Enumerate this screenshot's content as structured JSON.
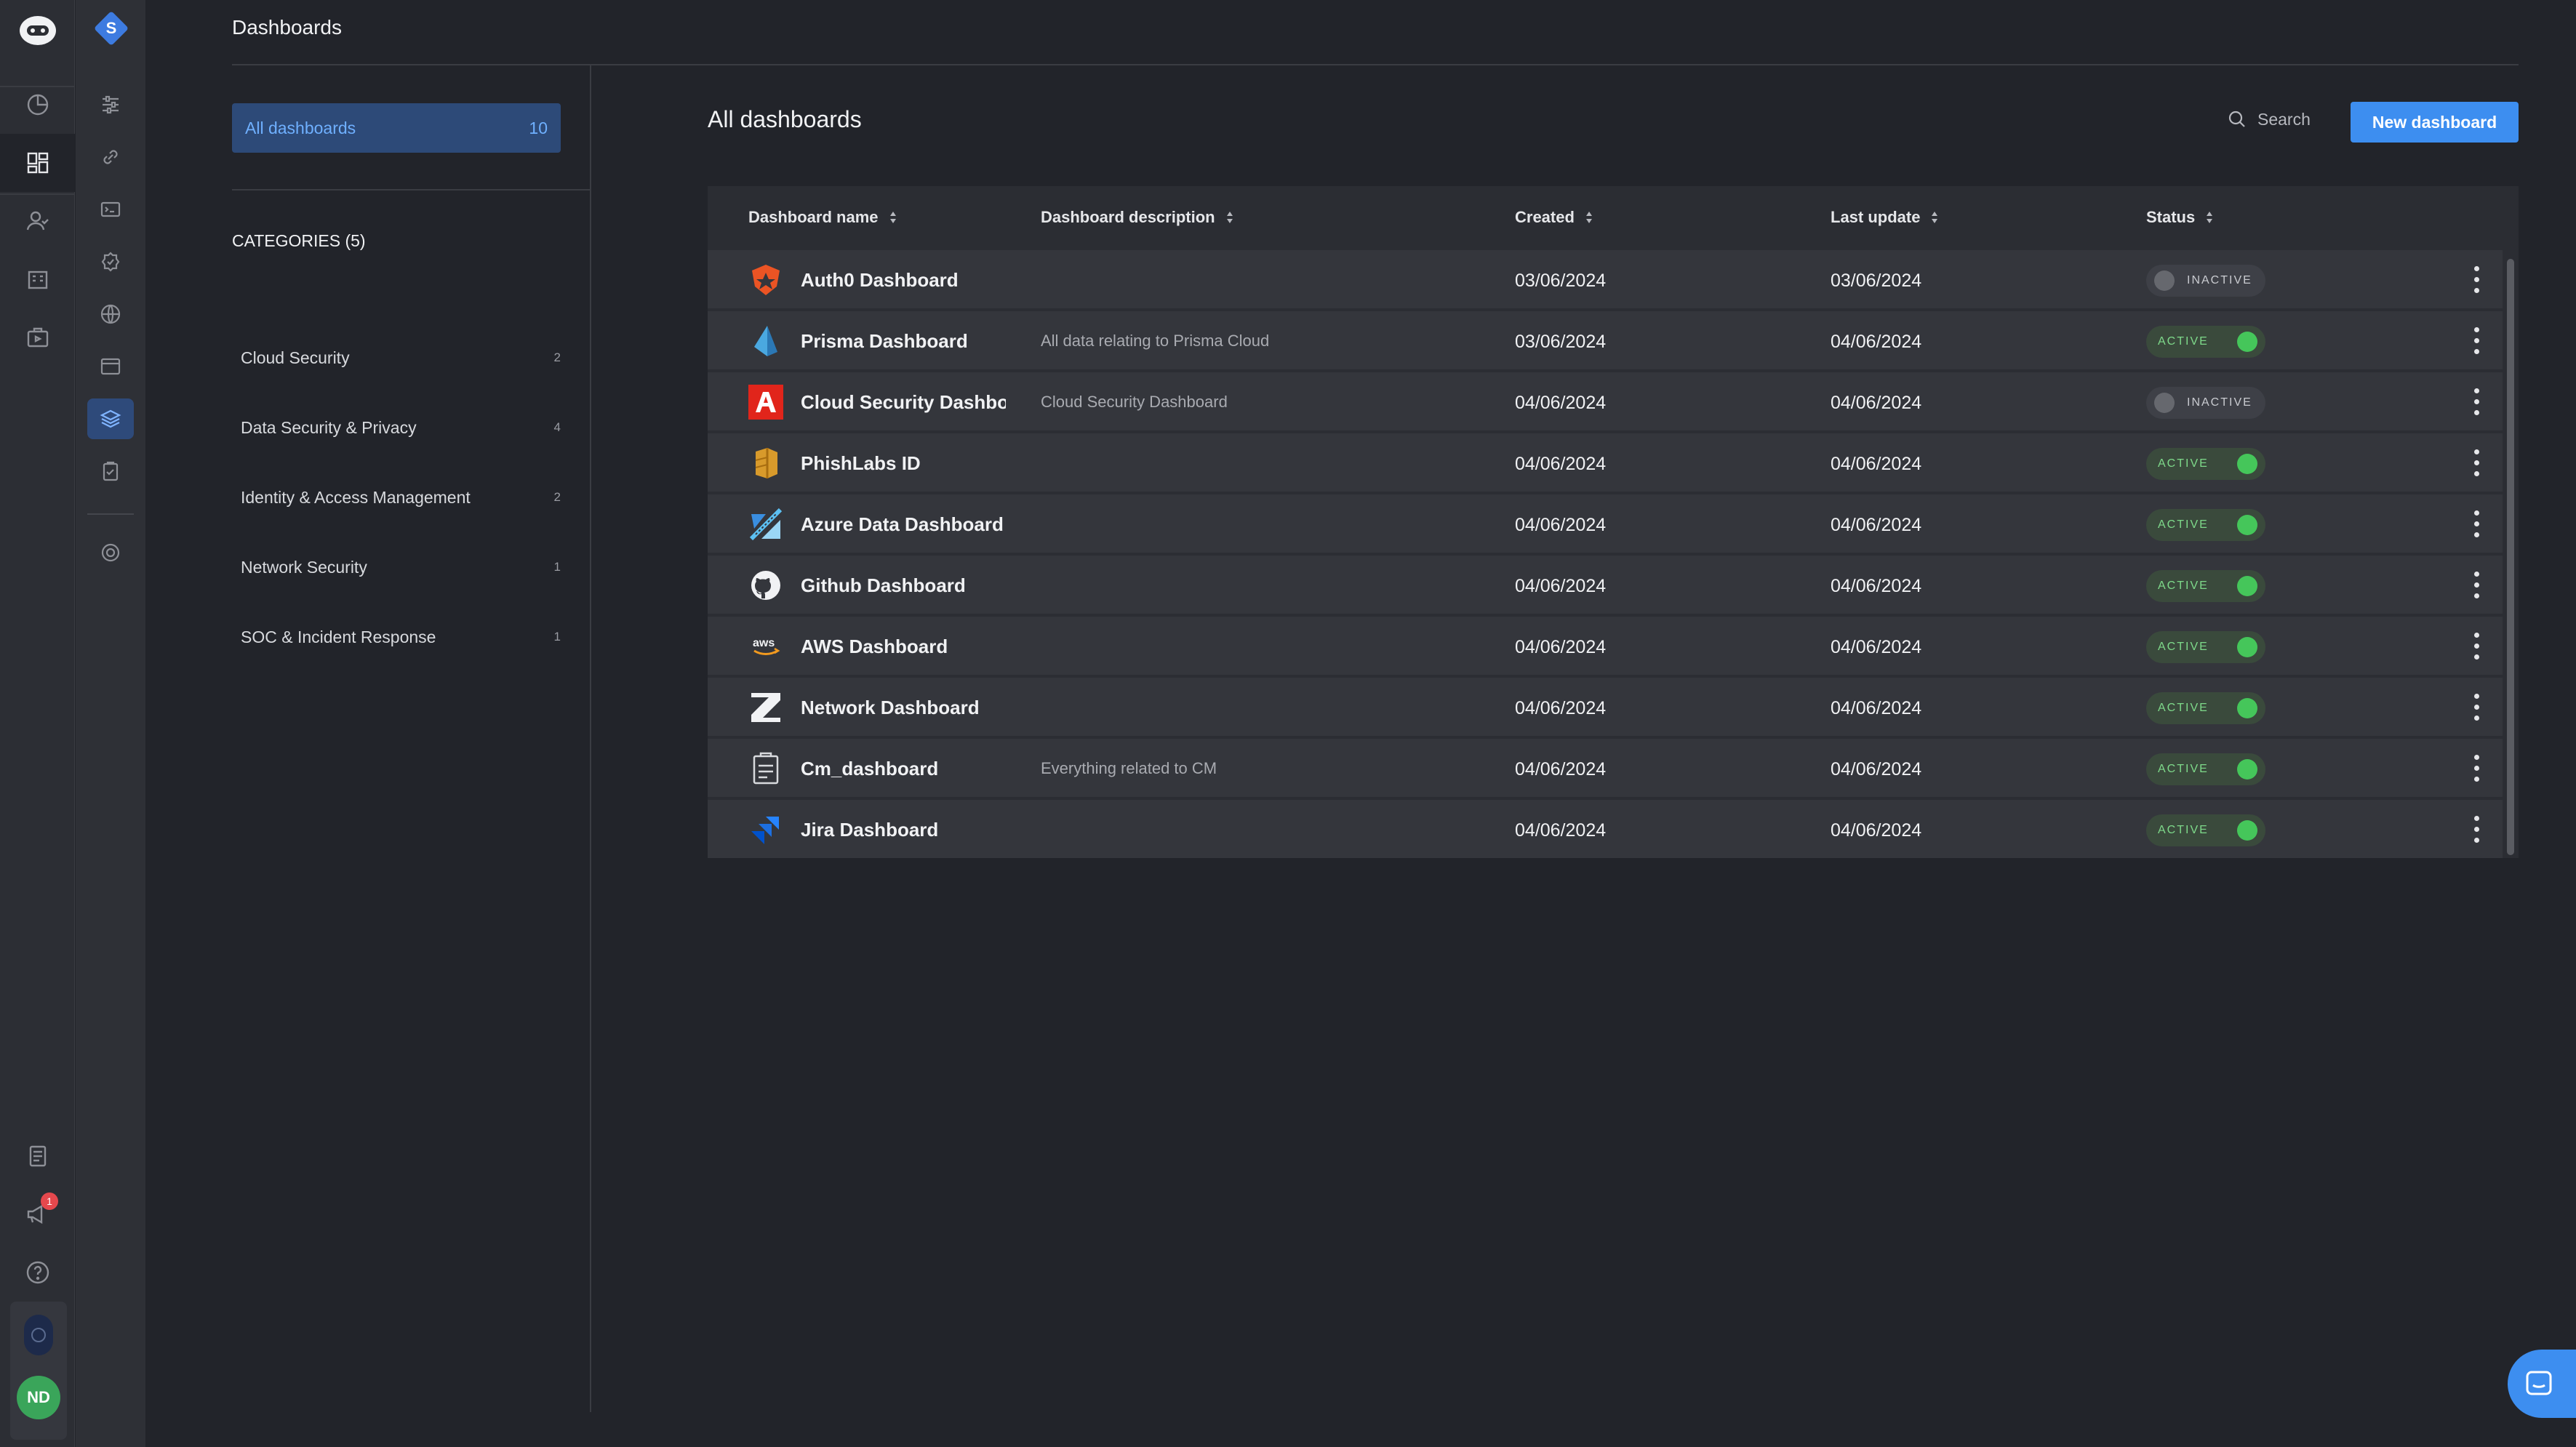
{
  "header": {
    "title": "Dashboards"
  },
  "workspace": {
    "letter": "S"
  },
  "user": {
    "initials": "ND",
    "notification_count": "1"
  },
  "sidebar": {
    "all": {
      "label": "All dashboards",
      "count": "10"
    },
    "categories_heading": "CATEGORIES (5)",
    "categories": [
      {
        "label": "Cloud Security",
        "count": "2"
      },
      {
        "label": "Data Security & Privacy",
        "count": "4"
      },
      {
        "label": "Identity & Access Management",
        "count": "2"
      },
      {
        "label": "Network Security",
        "count": "1"
      },
      {
        "label": "SOC & Incident Response",
        "count": "1"
      }
    ]
  },
  "main": {
    "title": "All dashboards",
    "search_label": "Search",
    "new_button": "New dashboard",
    "columns": {
      "name": "Dashboard name",
      "description": "Dashboard description",
      "created": "Created",
      "updated": "Last update",
      "status": "Status"
    },
    "rows": [
      {
        "name": "Auth0 Dashboard",
        "description": "",
        "created": "03/06/2024",
        "updated": "03/06/2024",
        "status": "INACTIVE",
        "icon": "auth0-icon"
      },
      {
        "name": "Prisma Dashboard",
        "description": "All data relating to Prisma Cloud",
        "created": "03/06/2024",
        "updated": "04/06/2024",
        "status": "ACTIVE",
        "icon": "prisma-icon"
      },
      {
        "name": "Cloud Security Dashboard",
        "description": "Cloud Security Dashboard",
        "created": "04/06/2024",
        "updated": "04/06/2024",
        "status": "INACTIVE",
        "icon": "adobe-icon"
      },
      {
        "name": "PhishLabs ID",
        "description": "",
        "created": "04/06/2024",
        "updated": "04/06/2024",
        "status": "ACTIVE",
        "icon": "phishlabs-icon"
      },
      {
        "name": "Azure Data Dashboard",
        "description": "",
        "created": "04/06/2024",
        "updated": "04/06/2024",
        "status": "ACTIVE",
        "icon": "azure-icon"
      },
      {
        "name": "Github Dashboard",
        "description": "",
        "created": "04/06/2024",
        "updated": "04/06/2024",
        "status": "ACTIVE",
        "icon": "github-icon"
      },
      {
        "name": "AWS Dashboard",
        "description": "",
        "created": "04/06/2024",
        "updated": "04/06/2024",
        "status": "ACTIVE",
        "icon": "aws-icon"
      },
      {
        "name": "Network Dashboard",
        "description": "",
        "created": "04/06/2024",
        "updated": "04/06/2024",
        "status": "ACTIVE",
        "icon": "zscaler-icon"
      },
      {
        "name": "Cm_dashboard",
        "description": "Everything related to CM",
        "created": "04/06/2024",
        "updated": "04/06/2024",
        "status": "ACTIVE",
        "icon": "clipboard-icon"
      },
      {
        "name": "Jira Dashboard",
        "description": "",
        "created": "04/06/2024",
        "updated": "04/06/2024",
        "status": "ACTIVE",
        "icon": "jira-icon"
      }
    ]
  },
  "colors": {
    "accent": "#3d8ef0",
    "active": "#45c65a",
    "background": "#22242a",
    "selected": "#2d4a78"
  }
}
